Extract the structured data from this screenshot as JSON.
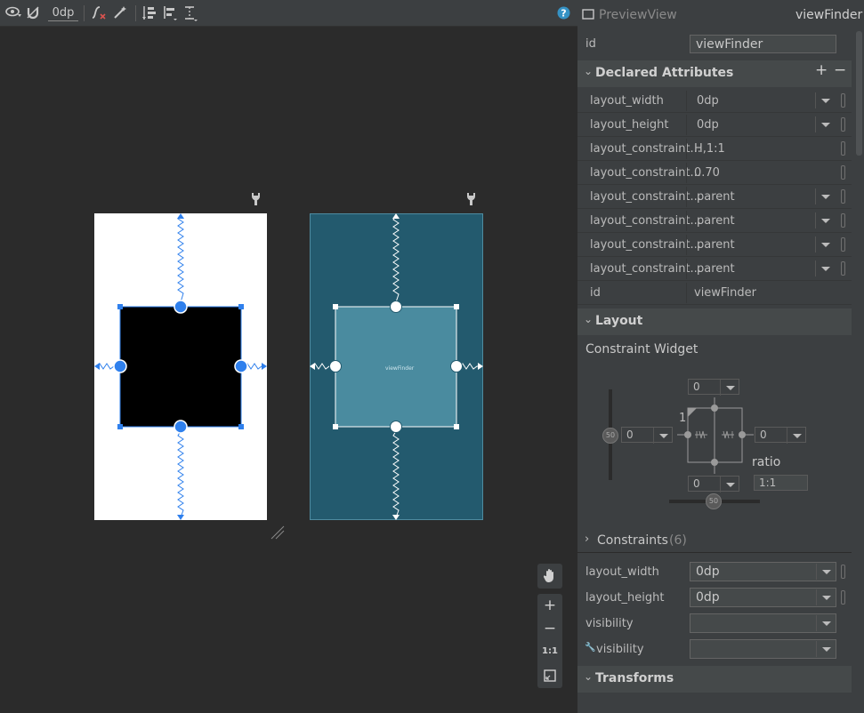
{
  "toolbar": {
    "margin_value": "0dp",
    "icons": [
      "eye-icon",
      "magnet-icon",
      "clear-constraints-icon",
      "infer-constraints-icon",
      "pack-icon",
      "align-icon",
      "guideline-icon",
      "help-icon"
    ]
  },
  "preview": {
    "design_label": "viewFinder",
    "wrench_icon": "wrench-icon"
  },
  "zoom_controls": {
    "pan": "✋",
    "zoom_in": "+",
    "zoom_out": "−",
    "actual": "1:1"
  },
  "panel": {
    "class_name": "PreviewView",
    "component_id": "viewFinder",
    "id_label": "id",
    "id_value": "viewFinder",
    "declared_title": "Declared Attributes",
    "declared": [
      {
        "label": "layout_width",
        "value": "0dp",
        "dropdown": true
      },
      {
        "label": "layout_height",
        "value": "0dp",
        "dropdown": true
      },
      {
        "label": "layout_constraint...",
        "value": "H,1:1",
        "dropdown": false
      },
      {
        "label": "layout_constraint...",
        "value": "0.70",
        "dropdown": false
      },
      {
        "label": "layout_constraint...",
        "value": "parent",
        "dropdown": true
      },
      {
        "label": "layout_constraint...",
        "value": "parent",
        "dropdown": true
      },
      {
        "label": "layout_constraint...",
        "value": "parent",
        "dropdown": true
      },
      {
        "label": "layout_constraint...",
        "value": "parent",
        "dropdown": true
      },
      {
        "label": "id",
        "value": "viewFinder",
        "dropdown": false
      }
    ],
    "layout_title": "Layout",
    "constraint_widget_title": "Constraint Widget",
    "cw": {
      "top_margin": "0",
      "left_margin": "0",
      "right_margin": "0",
      "bottom_margin": "0",
      "vbias": "50",
      "hbias": "50",
      "ratio_label": "ratio",
      "ratio_value": "1:1",
      "ratio_side": "1"
    },
    "constraints_title": "Constraints",
    "constraints_count": "(6)",
    "lower": [
      {
        "label": "layout_width",
        "value": "0dp"
      },
      {
        "label": "layout_height",
        "value": "0dp"
      },
      {
        "label": "visibility",
        "value": ""
      },
      {
        "label": "visibility",
        "value": ""
      }
    ],
    "transforms_title": "Transforms"
  }
}
